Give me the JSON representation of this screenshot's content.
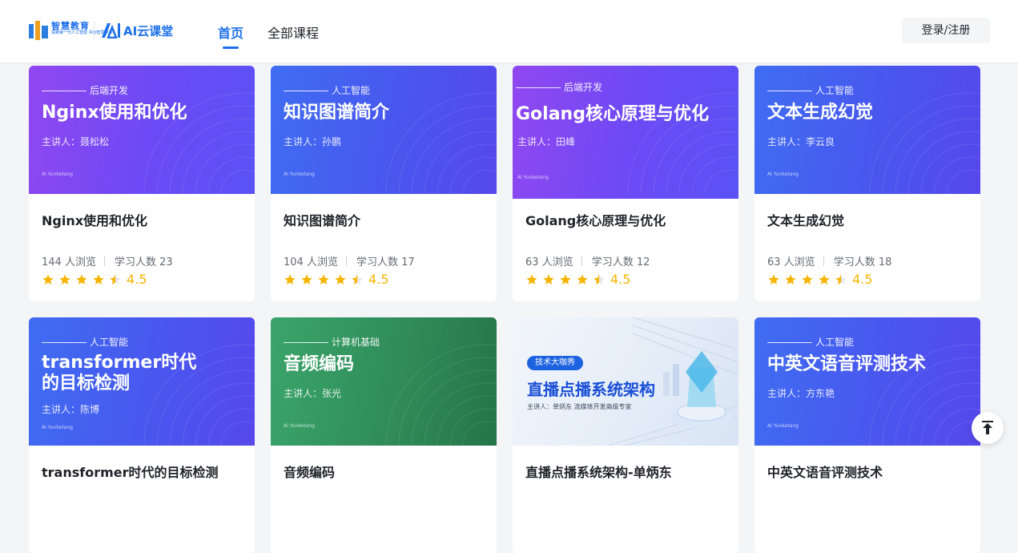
{
  "header": {
    "logo_primary_text": "智慧教育",
    "logo_primary_sub": "探索第一代人工智能 共创智慧未来",
    "logo_secondary_text": "AI云课堂",
    "nav": [
      {
        "label": "首页",
        "active": true
      },
      {
        "label": "全部课程",
        "active": false
      }
    ],
    "login_label": "登录/注册"
  },
  "courses": [
    {
      "title": "Nginx使用和优化",
      "category": "后端开发",
      "cover_title": "Nginx使用和优化",
      "lecturer": "主讲人：聂松松",
      "views": "144 人浏览",
      "learners": "学习人数 23",
      "rating": 4.5,
      "rating_text": "4.5",
      "brand": "AI Yunketang",
      "theme": "purple"
    },
    {
      "title": "知识图谱简介",
      "category": "人工智能",
      "cover_title": "知识图谱简介",
      "lecturer": "主讲人：孙鹏",
      "views": "104 人浏览",
      "learners": "学习人数 17",
      "rating": 4.5,
      "rating_text": "4.5",
      "brand": "AI Yunketang",
      "theme": "blue"
    },
    {
      "title": "Golang核心原理与优化",
      "category": "后端开发",
      "cover_title": "Golang核心原理与优化",
      "lecturer": "主讲人：田峰",
      "views": "63 人浏览",
      "learners": "学习人数 12",
      "rating": 4.5,
      "rating_text": "4.5",
      "brand": "AI Yunketang",
      "theme": "purple"
    },
    {
      "title": "文本生成幻觉",
      "category": "人工智能",
      "cover_title": "文本生成幻觉",
      "lecturer": "主讲人：李云良",
      "views": "63 人浏览",
      "learners": "学习人数 18",
      "rating": 4.5,
      "rating_text": "4.5",
      "brand": "AI Yunketang",
      "theme": "blue"
    },
    {
      "title": "transformer时代的目标检测",
      "category": "人工智能",
      "cover_title_line1": "transformer时代",
      "cover_title_line2": "的目标检测",
      "lecturer": "主讲人：陈博",
      "brand": "AI Yunketang",
      "theme": "blue"
    },
    {
      "title": "音频编码",
      "category": "计算机基础",
      "cover_title": "音频编码",
      "lecturer": "主讲人：张光",
      "brand": "AI Yunketang",
      "theme": "green"
    },
    {
      "title": "直播点播系统架构-单炳东",
      "photo_badge": "技术大咖秀",
      "photo_title": "直播点播系统架构",
      "photo_sub": "主讲人：单炳东 流媒体开发高级专家",
      "theme": "photo"
    },
    {
      "title": "中英文语音评测技术",
      "category": "人工智能",
      "cover_title": "中英文语音评测技术",
      "lecturer": "主讲人：方东艳",
      "brand": "AI Yunketang",
      "theme": "blue"
    }
  ],
  "colors": {
    "accent": "#1d6fe8",
    "star": "#f7b500",
    "star_empty": "#e5e6eb",
    "purple_cover": "#7b48f2",
    "blue_cover": "#4a5ef0",
    "green_cover": "#2f8a57"
  },
  "icons": {
    "back_to_top": "back-to-top-icon",
    "star": "star-icon"
  }
}
